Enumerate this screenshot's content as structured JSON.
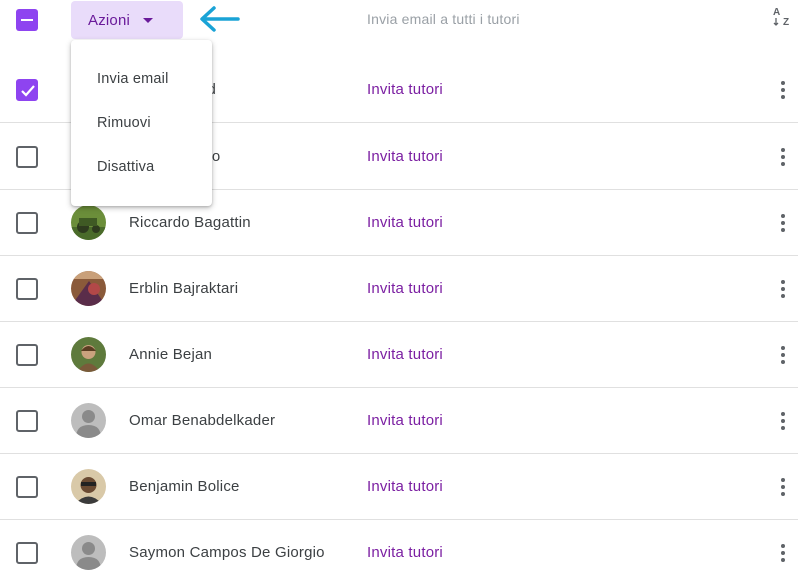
{
  "header": {
    "actions_label": "Azioni",
    "email_all_label": "Invia email a tutti i tutori",
    "sort_icon": "sort-az-icon",
    "arrow_color": "#1aa3d6"
  },
  "menu": {
    "items": [
      {
        "label": "Invia email"
      },
      {
        "label": "Rimuovi"
      },
      {
        "label": "Disattiva"
      }
    ]
  },
  "rows": [
    {
      "name": "ed",
      "checked": true,
      "invite": "Invita tutori",
      "avatar": "hidden"
    },
    {
      "name": "ato",
      "checked": false,
      "invite": "Invita tutori",
      "avatar": "hidden"
    },
    {
      "name": "Riccardo Bagattin",
      "checked": false,
      "invite": "Invita tutori",
      "avatar": "photo"
    },
    {
      "name": "Erblin Bajraktari",
      "checked": false,
      "invite": "Invita tutori",
      "avatar": "photo"
    },
    {
      "name": "Annie Bejan",
      "checked": false,
      "invite": "Invita tutori",
      "avatar": "photo"
    },
    {
      "name": "Omar Benabdelkader",
      "checked": false,
      "invite": "Invita tutori",
      "avatar": "default"
    },
    {
      "name": "Benjamin Bolice",
      "checked": false,
      "invite": "Invita tutori",
      "avatar": "photo"
    },
    {
      "name": "Saymon Campos De Giorgio",
      "checked": false,
      "invite": "Invita tutori",
      "avatar": "default"
    }
  ],
  "colors": {
    "accent": "#8e44f0",
    "link": "#7b1fa2",
    "button_bg": "#e9dcfa"
  }
}
